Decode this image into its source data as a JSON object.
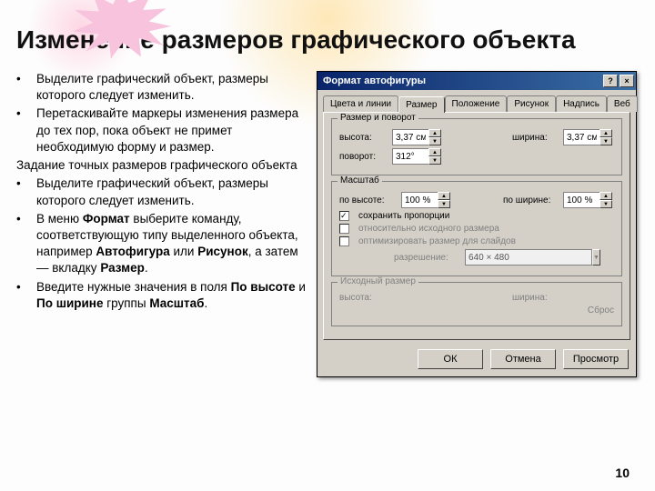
{
  "slide": {
    "title": "Изменение размеров графического объекта",
    "page_number": "10"
  },
  "text": {
    "bullets1": [
      "Выделите графический объект, размеры которого следует изменить.",
      "Перетаскивайте маркеры изменения размера до тех пор, пока объект не примет необходимую форму и размер."
    ],
    "subhead": "Задание точных размеров графического объекта",
    "bullets2_a": "Выделите графический объект, размеры которого следует изменить.",
    "bullets2_b_pre": "В меню ",
    "bullets2_b_b1": "Формат",
    "bullets2_b_mid1": " выберите команду, соответствующую типу выделенного объекта, например ",
    "bullets2_b_b2": "Автофигура",
    "bullets2_b_mid2": " или ",
    "bullets2_b_b3": "Рисунок",
    "bullets2_b_mid3": ", а затем — вкладку ",
    "bullets2_b_b4": "Размер",
    "bullets2_b_end": ".",
    "bullets2_c_pre": "Введите нужные значения в поля ",
    "bullets2_c_b1": "По высоте",
    "bullets2_c_mid": " и ",
    "bullets2_c_b2": "По ширине",
    "bullets2_c_mid2": " группы ",
    "bullets2_c_b3": "Масштаб",
    "bullets2_c_end": "."
  },
  "dialog": {
    "title": "Формат автофигуры",
    "closeHelp": "?",
    "closeX": "×",
    "tabs": [
      "Цвета и линии",
      "Размер",
      "Положение",
      "Рисунок",
      "Надпись",
      "Веб"
    ],
    "activeTab": 1,
    "groups": {
      "size": {
        "title": "Размер и поворот",
        "heightLabel": "высота:",
        "heightValue": "3,37 см",
        "widthLabel": "ширина:",
        "widthValue": "3,37 см",
        "rotationLabel": "поворот:",
        "rotationValue": "312°"
      },
      "scale": {
        "title": "Масштаб",
        "byHeightLabel": "по высоте:",
        "byHeightValue": "100 %",
        "byWidthLabel": "по ширине:",
        "byWidthValue": "100 %",
        "keepRatio": "сохранить пропорции",
        "relOriginal": "относительно исходного размера",
        "bestSlideshow": "оптимизировать размер для слайдов",
        "resLabel": "разрешение:",
        "resValue": "640 × 480"
      },
      "orig": {
        "title": "Исходный размер",
        "heightLabel": "высота:",
        "widthLabel": "ширина:",
        "reset": "Сброс"
      }
    },
    "buttons": {
      "ok": "ОК",
      "cancel": "Отмена",
      "preview": "Просмотр"
    }
  }
}
